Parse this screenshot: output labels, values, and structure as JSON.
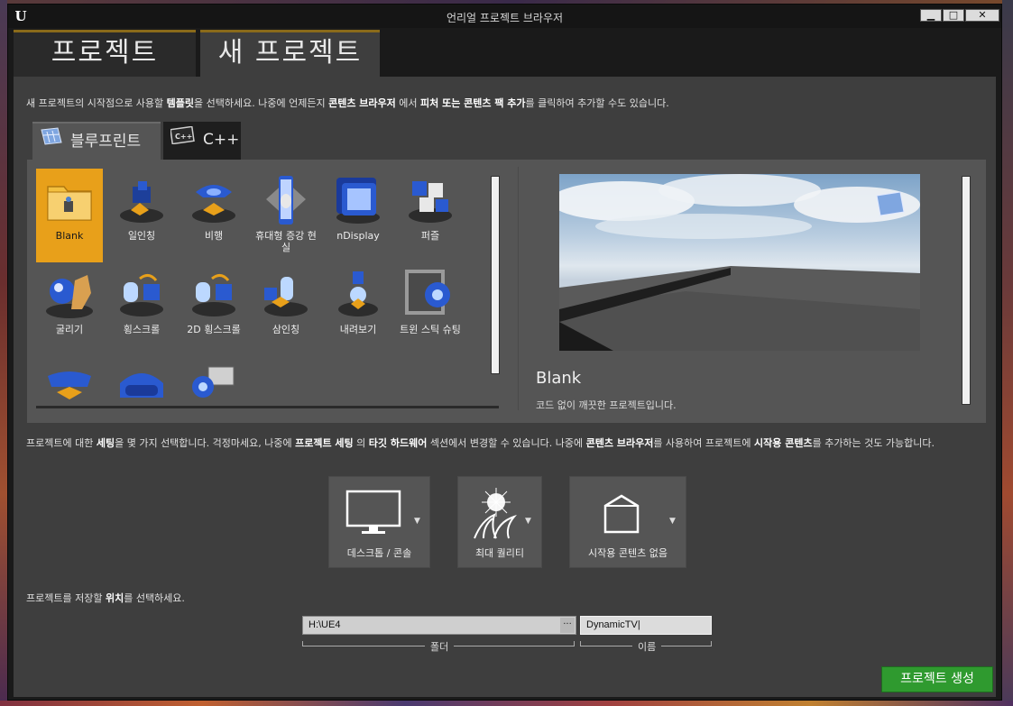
{
  "window": {
    "title": "언리얼 프로젝트 브라우저",
    "logo_text": "U",
    "controls": {
      "minimize": "▁",
      "maximize": "□",
      "close": "✕"
    }
  },
  "main_tabs": [
    {
      "label": "프로젝트",
      "active": false
    },
    {
      "label": "새 프로젝트",
      "active": true
    }
  ],
  "intro": {
    "p1": "새 프로젝트의 시작점으로 사용할 ",
    "b1": "템플릿",
    "p2": "을 선택하세요. 나중에 언제든지 ",
    "b2": "콘텐츠 브라우저",
    "p3": " 에서 ",
    "b3": "피처 또는 콘텐츠 팩 추가",
    "p4": "를 클릭하여 추가할 수도 있습니다."
  },
  "sub_tabs": [
    {
      "label": "블루프린트",
      "icon": "blueprint-icon",
      "active": true
    },
    {
      "label": "C++",
      "icon": "cpp-icon",
      "active": false
    }
  ],
  "templates": [
    {
      "label": "Blank",
      "icon": "folder-icon",
      "selected": true
    },
    {
      "label": "일인칭",
      "icon": "first-person-icon"
    },
    {
      "label": "비행",
      "icon": "flying-icon"
    },
    {
      "label": "휴대형 증강 현실",
      "icon": "handheld-ar-icon"
    },
    {
      "label": "nDisplay",
      "icon": "ndisplay-icon"
    },
    {
      "label": "퍼즐",
      "icon": "puzzle-icon"
    },
    {
      "label": "굴리기",
      "icon": "rolling-icon"
    },
    {
      "label": "횡스크롤",
      "icon": "side-scroller-icon"
    },
    {
      "label": "2D 횡스크롤",
      "icon": "2d-side-scroller-icon"
    },
    {
      "label": "삼인칭",
      "icon": "third-person-icon"
    },
    {
      "label": "내려보기",
      "icon": "top-down-icon"
    },
    {
      "label": "트윈 스틱 슈팅",
      "icon": "twin-stick-icon"
    },
    {
      "label": "",
      "icon": "vehicle-icon"
    },
    {
      "label": "",
      "icon": "vr-icon"
    },
    {
      "label": "",
      "icon": "virtual-production-icon"
    }
  ],
  "preview": {
    "title": "Blank",
    "description": "코드 없이 깨끗한 프로젝트입니다."
  },
  "settings": {
    "p1": "프로젝트에 대한 ",
    "b1": "세팅",
    "p2": "을 몇 가지 선택합니다. 걱정마세요, 나중에 ",
    "b2": "프로젝트 세팅",
    "p3": " 의 ",
    "b3": "타깃 하드웨어",
    "p4": " 섹션에서 변경할 수 있습니다. 나중에 ",
    "b4": "콘텐츠 브라우저",
    "p5": "를 사용하여 프로젝트에 ",
    "b5": "시작용 콘텐츠",
    "p6": "를 추가하는 것도 가능합니다.",
    "options": [
      {
        "label": "데스크톱 / 콘솔",
        "icon": "monitor-icon"
      },
      {
        "label": "최대 퀄리티",
        "icon": "quality-icon"
      },
      {
        "label": "시작용 콘텐츠 없음",
        "icon": "empty-box-icon"
      }
    ]
  },
  "location": {
    "p1": "프로젝트를 저장할 ",
    "b1": "위치",
    "p2": "를 선택하세요.",
    "folder_value": "H:\\UE4",
    "browse_label": "···",
    "name_value": "DynamicTV",
    "folder_caption": "폴더",
    "name_caption": "이름"
  },
  "create_button": "프로젝트 생성",
  "colors": {
    "accent": "#e8a01a",
    "create": "#2f9a2f",
    "panel": "#555555",
    "bg": "#3e3e3e"
  }
}
